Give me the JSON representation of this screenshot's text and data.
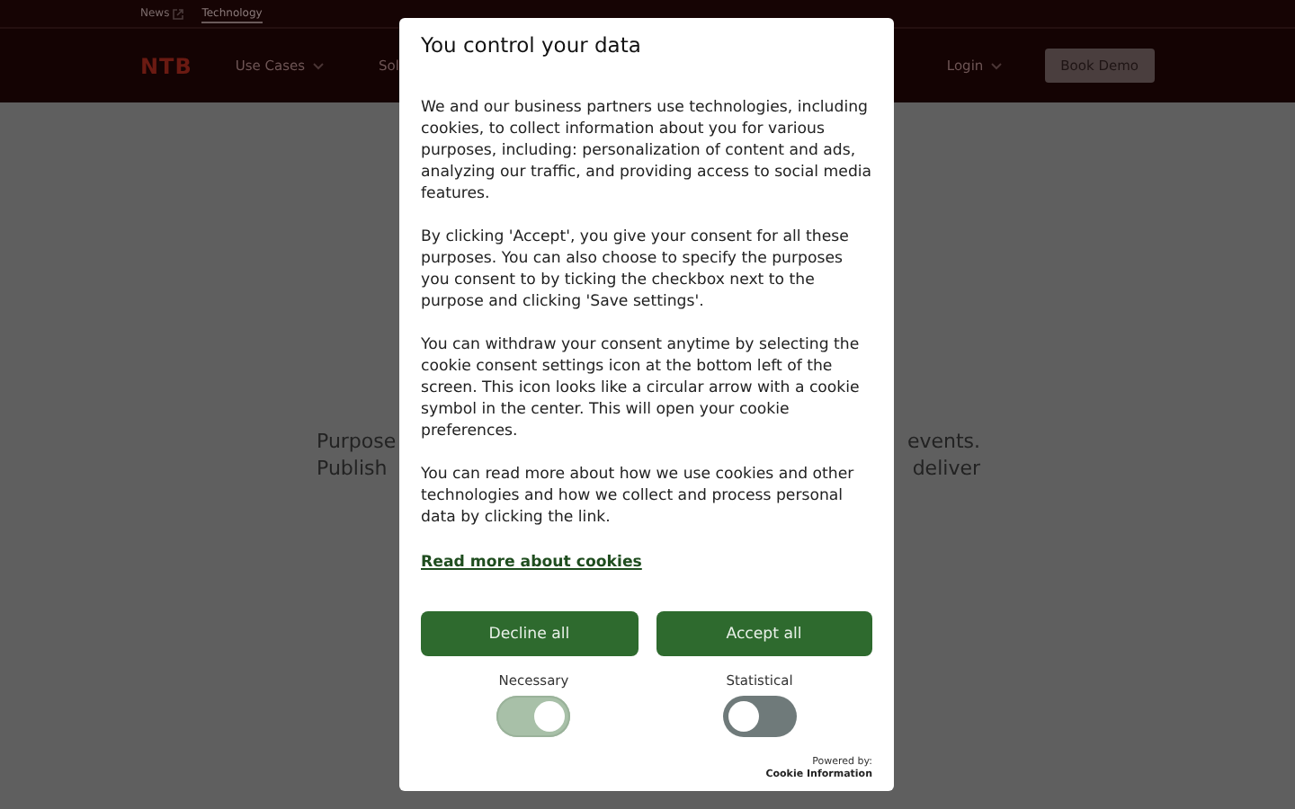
{
  "top_bar": {
    "links": [
      {
        "label": "News",
        "external": true,
        "selected": false
      },
      {
        "label": "Technology",
        "external": false,
        "selected": true
      }
    ]
  },
  "nav": {
    "logo": "NTB",
    "items": [
      {
        "label": "Use Cases",
        "dropdown": true
      },
      {
        "label": "Sol",
        "dropdown": false
      }
    ],
    "login": {
      "label": "Login",
      "dropdown": true
    },
    "cta": "Book Demo"
  },
  "background_text": {
    "left_lines": [
      "Purpose",
      "Publish"
    ],
    "right_lines": [
      "events.",
      "deliver"
    ]
  },
  "dialog": {
    "title": "You control your data",
    "paragraphs": [
      "We and our business partners use technologies, including cookies, to collect information about you for various purposes, including: personalization of content and ads, analyzing our traffic, and providing access to social media features.",
      "By clicking 'Accept', you give your consent for all these purposes. You can also choose to specify the purposes you consent to by ticking the checkbox next to the purpose and clicking 'Save settings'.",
      "You can withdraw your consent anytime by selecting the cookie consent settings icon at the bottom left of the screen. This icon looks like a circular arrow with a cookie symbol in the center. This will open your cookie preferences.",
      "You can read more about how we use cookies and other technologies and how we collect and process personal data by clicking the link."
    ],
    "link": "Read more about cookies",
    "buttons": [
      "Decline all",
      "Accept all"
    ],
    "toggles": [
      {
        "label": "Necessary",
        "on": true,
        "disabled": true
      },
      {
        "label": "Statistical",
        "on": false,
        "disabled": false
      }
    ],
    "powered_by": "Powered by:",
    "provider": "Cookie Information"
  }
}
